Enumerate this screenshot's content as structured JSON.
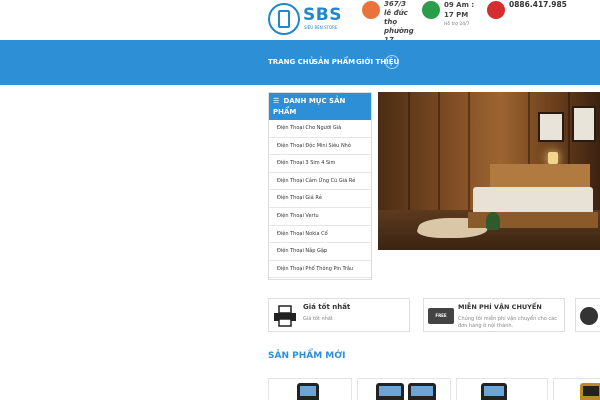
{
  "header": {
    "logo_text": "SBS",
    "logo_sub": "SIÊU BÉN STORE",
    "address": "367/3 lê đức thọ phường 17",
    "hours": "09 Am : 17 PM",
    "support": "Hỗ trợ 24/7",
    "hotline": "0886.417.985"
  },
  "nav": {
    "items": [
      "TRANG CHỦ",
      "SẢN PHẨM",
      "GIỚI THIỆU"
    ]
  },
  "sidebar": {
    "title": "DANH MỤC SẢN PHẨM",
    "items": [
      "Điện Thoại Cho Người Già",
      "Điện Thoại Độc Mini Siêu Nhỏ",
      "Điện Thoại 3 Sim 4 Sim",
      "Điện Thoại Cảm Ứng Cũ Giá Rẻ",
      "Điện Thoại Giá Rẻ",
      "Điện Thoại Vertu",
      "Điện Thoại Nokia Cổ",
      "Điện Thoại Nắp Gập",
      "Điện Thoại Phổ Thông Pin Trâu"
    ]
  },
  "features": [
    {
      "title": "Giá tốt nhất",
      "desc": "Giá tốt nhất",
      "icon": "printer-icon"
    },
    {
      "title": "MIỄN PHÍ VẬN CHUYỂN",
      "desc": "Chúng tôi miễn phí vận chuyển cho các đơn hàng ở nội thành.",
      "icon": "truck-icon",
      "badge": "FREE"
    },
    {
      "title": "",
      "desc": "",
      "icon": "support-icon"
    }
  ],
  "section": {
    "new_products": "SẢN PHẨM MỚI"
  },
  "colors": {
    "brand": "#2d8fd5",
    "logo": "#1e88c8"
  }
}
